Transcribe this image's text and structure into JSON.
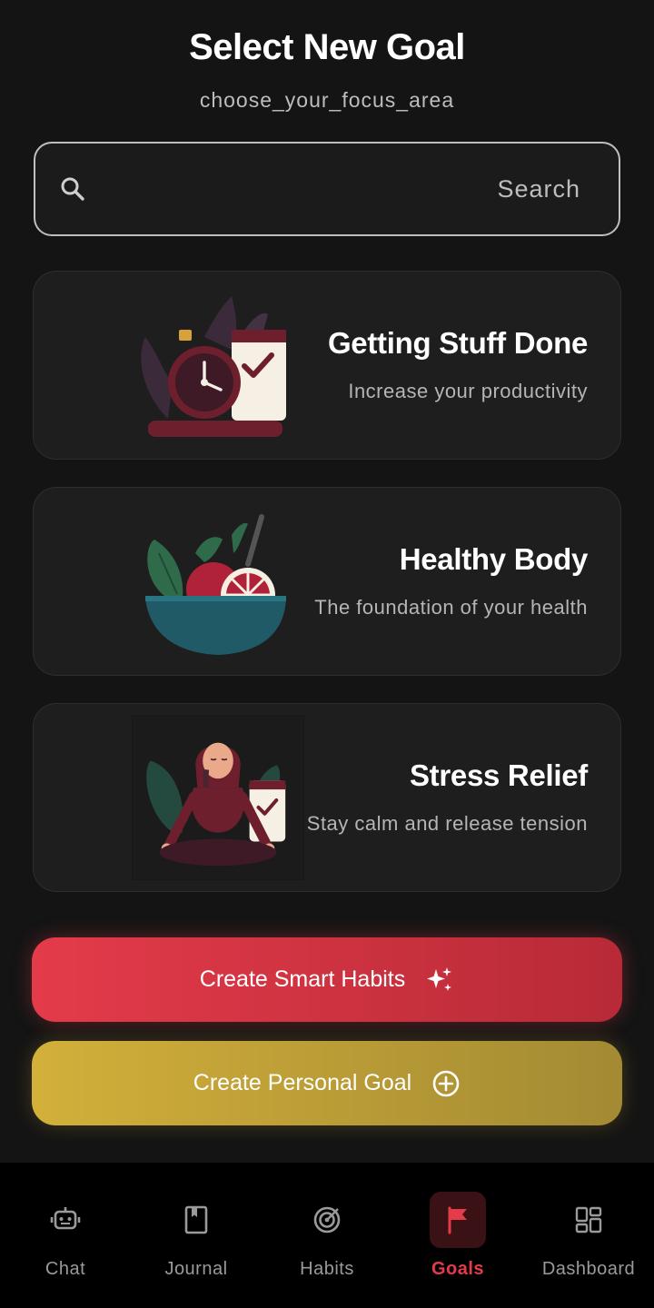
{
  "header": {
    "title": "Select New Goal",
    "subtitle": "choose_your_focus_area"
  },
  "search": {
    "placeholder": "Search",
    "value": "",
    "icon": "search-icon"
  },
  "goals": [
    {
      "title": "Getting Stuff Done",
      "description": "Increase your productivity",
      "illustration": "stopwatch-checklist-illustration"
    },
    {
      "title": "Healthy Body",
      "description": "The foundation of your health",
      "illustration": "fruit-bowl-illustration"
    },
    {
      "title": "Stress Relief",
      "description": "Stay calm and release tension",
      "illustration": "meditation-illustration"
    }
  ],
  "actions": {
    "smart_habits": {
      "label": "Create Smart Habits",
      "icon": "sparkle-icon",
      "color": "#e43b4a"
    },
    "personal_goal": {
      "label": "Create Personal Goal",
      "icon": "plus-circle-icon",
      "color": "#d3b03a"
    }
  },
  "nav": {
    "items": [
      {
        "label": "Chat",
        "icon": "robot-icon",
        "active": false
      },
      {
        "label": "Journal",
        "icon": "book-icon",
        "active": false
      },
      {
        "label": "Habits",
        "icon": "target-icon",
        "active": false
      },
      {
        "label": "Goals",
        "icon": "flag-icon",
        "active": true
      },
      {
        "label": "Dashboard",
        "icon": "dashboard-icon",
        "active": false
      }
    ],
    "active_color": "#e43b4a"
  }
}
